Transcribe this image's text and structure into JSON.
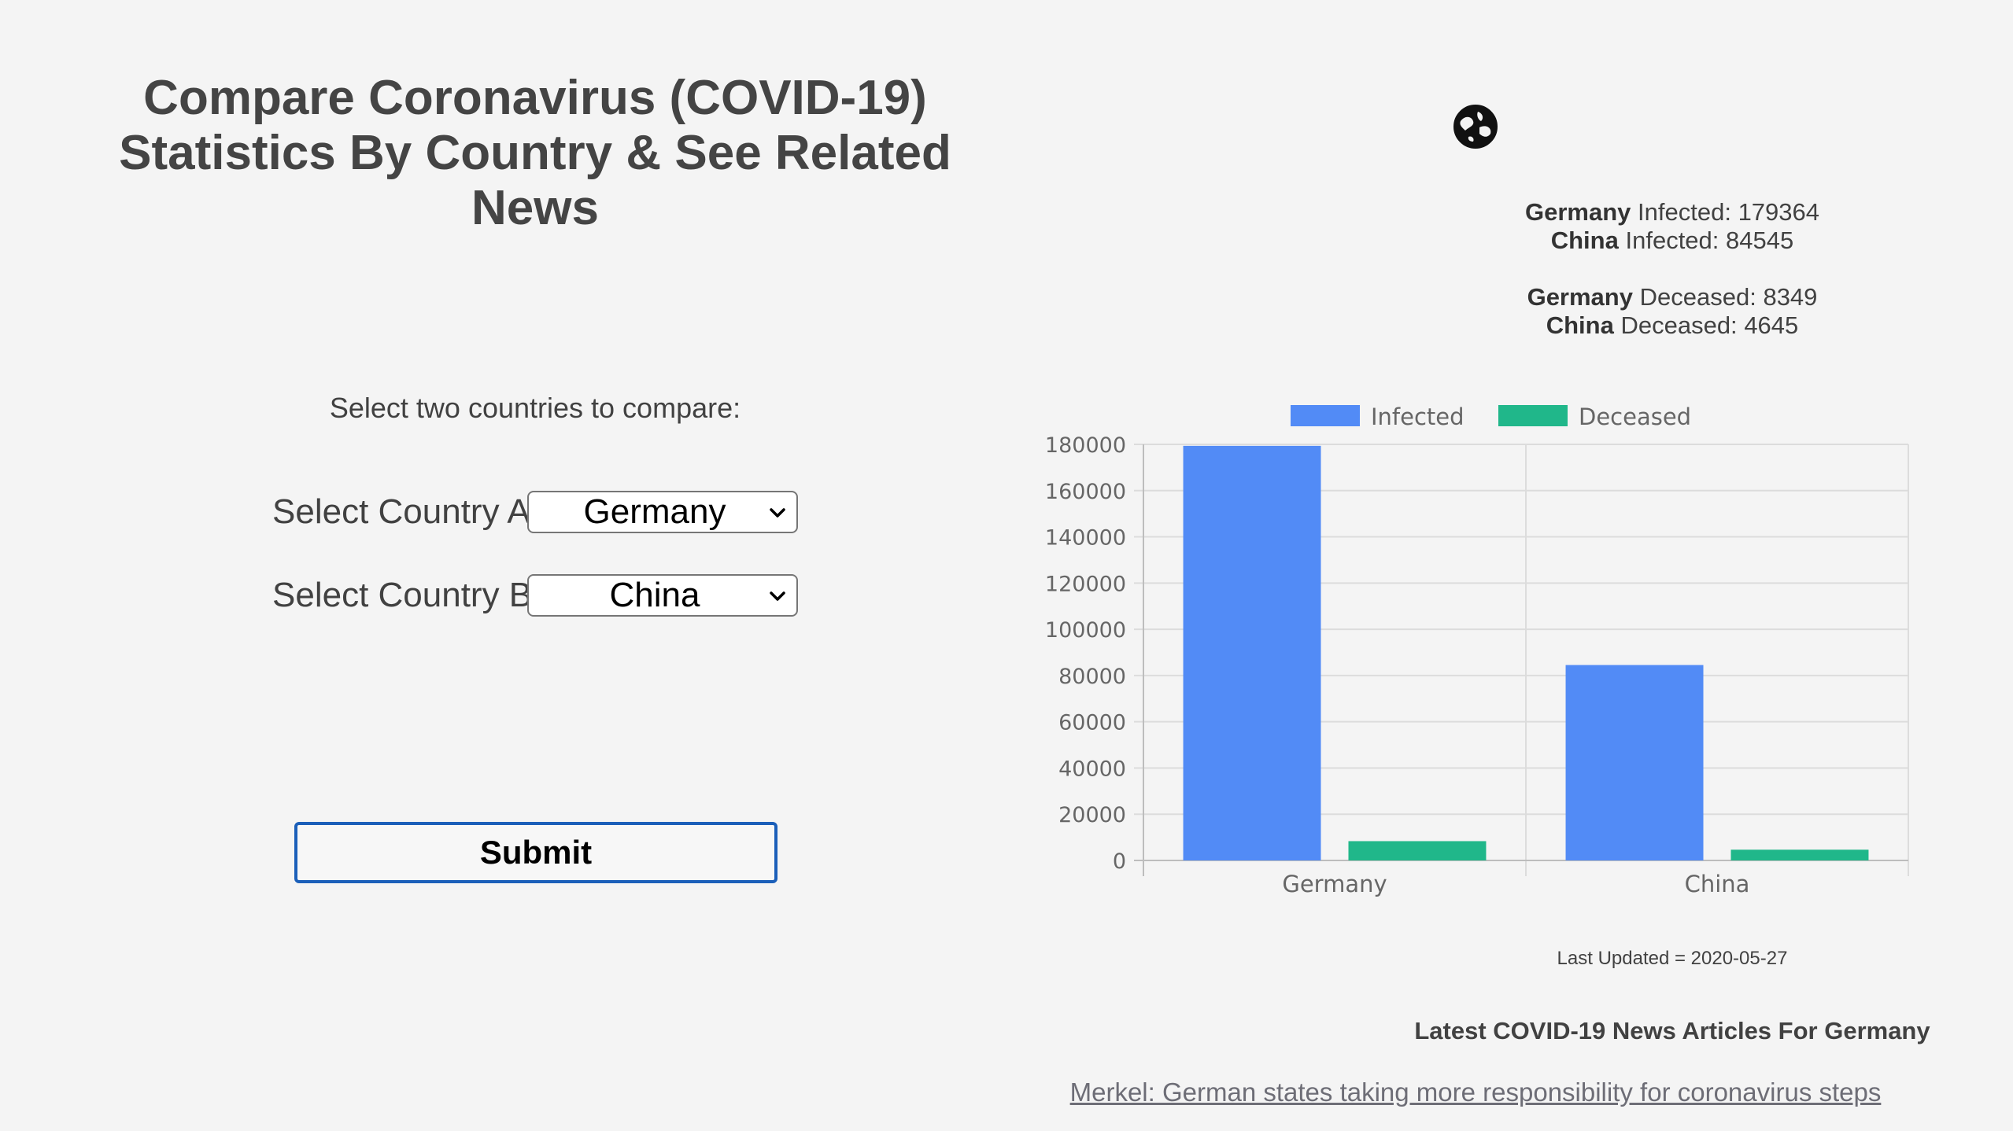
{
  "page": {
    "title": "Compare Coronavirus (COVID-19) Statistics By Country & See Related News",
    "instruction": "Select two countries to compare:"
  },
  "form": {
    "country_a": {
      "label": "Select Country A",
      "selected": "Germany"
    },
    "country_b": {
      "label": "Select Country B",
      "selected": "China"
    },
    "submit_label": "Submit"
  },
  "stats": {
    "country_a_name": "Germany",
    "country_b_name": "China",
    "infected_label": "Infected:",
    "deceased_label": "Deceased:",
    "country_a_infected": "179364",
    "country_b_infected": "84545",
    "country_a_deceased": "8349",
    "country_b_deceased": "4645"
  },
  "chart_data": {
    "type": "bar",
    "categories": [
      "Germany",
      "China"
    ],
    "series": [
      {
        "name": "Infected",
        "values": [
          179364,
          84545
        ],
        "color": "#528bf6"
      },
      {
        "name": "Deceased",
        "values": [
          8349,
          4645
        ],
        "color": "#20b78a"
      }
    ],
    "ylim": [
      0,
      180000
    ],
    "yticks": [
      0,
      20000,
      40000,
      60000,
      80000,
      100000,
      120000,
      140000,
      160000,
      180000
    ],
    "grid": true,
    "legend_position": "top"
  },
  "footer": {
    "last_updated": "Last Updated = 2020-05-27",
    "news_heading": "Latest COVID-19 News Articles For Germany",
    "news_link": "Merkel: German states taking more responsibility for coronavirus steps"
  },
  "icons": {
    "globe": "globe-icon",
    "select_chevron": "chevron-down-icon"
  }
}
